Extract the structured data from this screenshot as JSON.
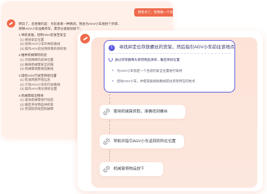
{
  "chat": {
    "user_message": "我有点了，帮我换一个思路",
    "answer_intro": "明白了，您想要的是：为您发来一种猜测，我会为AGV小车规划个步骤，保障AGV小车准确停车，需求分类规划如下：",
    "sections": [
      {
        "title": "1.导航发展，控制AGV前进至安全",
        "items": [
          "(1) 规划安全位置",
          "(2) 指导AGV小车的导航路线",
          "(3) 操作AGV前往预停靠的目的地"
        ]
      },
      {
        "title": "2.推导机械臂的轨迹",
        "items": [
          "(1) 识别障碍的具体位置",
          "(2) 确保机械臂安全间隔",
          "(3) 机械臂调整规划路线"
        ]
      },
      {
        "title": "3.操控AGV行驶至目标位置",
        "items": [
          "(1) 检测周围环境信息",
          "(2) 计划AGV小车的行驶路线",
          "(3) 操作AGV到达目标位置"
        ]
      },
      {
        "title": "4.机械臂取出物体",
        "items": [
          "(1) 驱动机械臂进行动态",
          "(2) 确定夹住物品并抓取",
          "(3) 完成取货收回机械臂"
        ]
      }
    ]
  },
  "flow": {
    "step1": {
      "number": "1",
      "title": "寻找并定位存放螺丝的货架，然后指引AGV小车前往该地点",
      "substeps": [
        "通过货架摄像头获得物品清单，确定目标位置",
        "为AGV小车指定一个合适的安全位置进行等待",
        "启动AGV小车，并使其按规划路线前往货架所在的地点"
      ]
    },
    "step2": {
      "label": "使用机械臂抓取，准确找到螺丝"
    },
    "step3": {
      "label": "导航并指引AGV小车返回到所在位置"
    },
    "step4": {
      "label": "机械臂将物品放下"
    }
  },
  "colors": {
    "accent": "#ef6a4c",
    "primary": "#5b5be0",
    "card_bg": "#fde3d7"
  }
}
